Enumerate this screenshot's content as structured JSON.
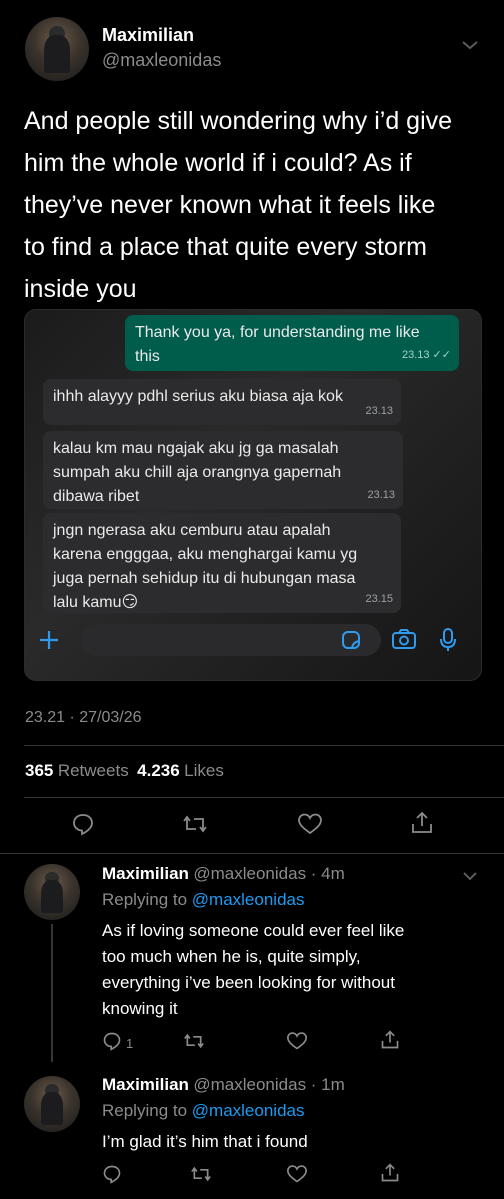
{
  "tweet": {
    "author_name": "Maximilian",
    "author_handle": "@maxleonidas",
    "text_lines": [
      "And people still wondering why i’d give",
      "him the whole world if i could? As if",
      "they’ve never known what it feels like",
      "to find a place that quite every storm",
      "inside you"
    ],
    "timestamp": "23.21 · 27/03/26",
    "retweets": "365",
    "retweets_label": "Retweets",
    "likes": "4.236",
    "likes_label": "Likes"
  },
  "chat": {
    "messages": [
      {
        "lines": [
          "Thank you ya, for understanding me like",
          "this"
        ],
        "time": "23.13 ✓✓",
        "dir": "out"
      },
      {
        "lines": [
          "ihhh alayyy pdhl serius aku biasa aja kok"
        ],
        "time": "23.13",
        "dir": "in"
      },
      {
        "lines": [
          "kalau km mau ngajak aku jg ga masalah",
          "sumpah aku chill aja orangnya gapernah",
          "dibawa ribet"
        ],
        "time": "23.13",
        "dir": "in"
      },
      {
        "lines": [
          "jngn ngerasa aku cemburu atau apalah",
          "karena engggaa, aku menghargai kamu yg",
          "juga pernah sehidup itu di hubungan masa",
          "lalu kamu😏"
        ],
        "time": "23.15",
        "dir": "in"
      }
    ]
  },
  "replies": [
    {
      "name": "Maximilian",
      "handle_time": "@maxleonidas · 4m",
      "replying_prefix": "Replying to ",
      "replying_to": "@maxleonidas",
      "lines": [
        "As if loving someone could ever feel like",
        "too much when he is, quite simply,",
        "everything i’ve been looking for without",
        "knowing it"
      ],
      "reply_count": "1"
    },
    {
      "name": "Maximilian",
      "handle_time": "@maxleonidas · 1m",
      "replying_prefix": "Replying to ",
      "replying_to": "@maxleonidas",
      "lines": [
        "I’m glad it’s him that i found"
      ],
      "reply_count": ""
    }
  ],
  "colors": {
    "accent": "#1d9bf0",
    "out_bubble": "#005c4b",
    "in_bubble": "#2c2c2e"
  },
  "icons": [
    "chevron-down-icon",
    "reply-icon",
    "retweet-icon",
    "like-icon",
    "share-icon",
    "plus-icon",
    "sticker-icon",
    "camera-icon",
    "microphone-icon",
    "double-check-icon"
  ]
}
